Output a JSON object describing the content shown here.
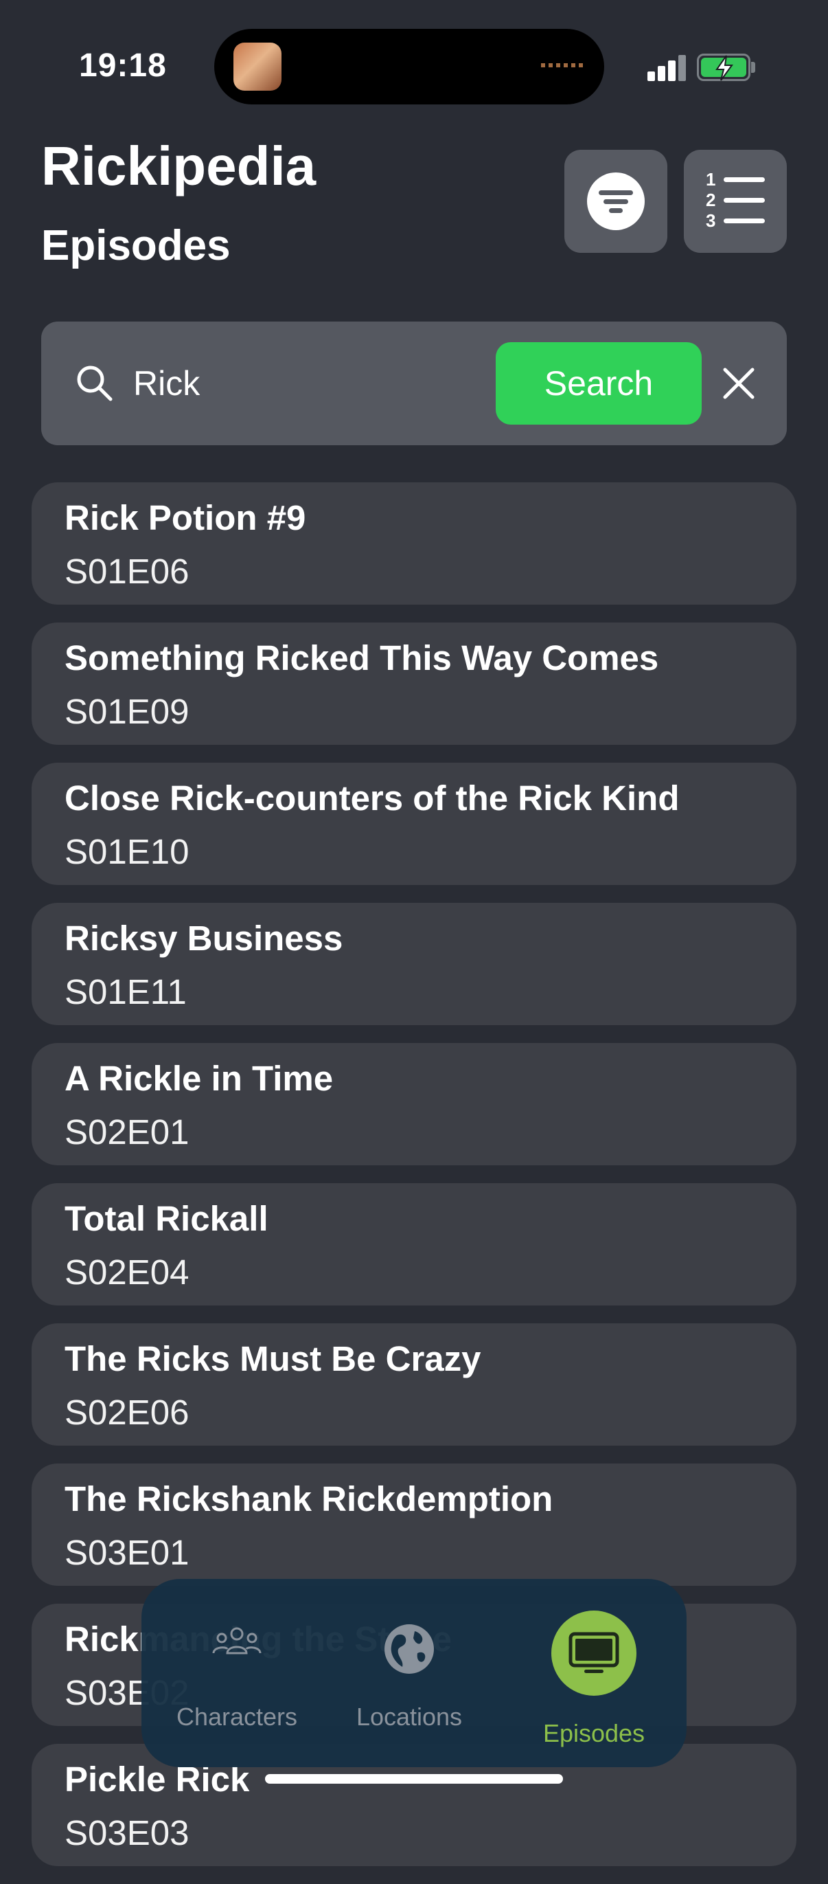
{
  "status_bar": {
    "time": "19:18"
  },
  "header": {
    "title": "Rickipedia",
    "subtitle": "Episodes"
  },
  "search": {
    "value": "Rick",
    "placeholder": "Search",
    "button_label": "Search"
  },
  "episodes": [
    {
      "name": "Rick Potion #9",
      "code": "S01E06"
    },
    {
      "name": "Something Ricked This Way Comes",
      "code": "S01E09"
    },
    {
      "name": "Close Rick-counters of the Rick Kind",
      "code": "S01E10"
    },
    {
      "name": "Ricksy Business",
      "code": "S01E11"
    },
    {
      "name": "A Rickle in Time",
      "code": "S02E01"
    },
    {
      "name": "Total Rickall",
      "code": "S02E04"
    },
    {
      "name": "The Ricks Must Be Crazy",
      "code": "S02E06"
    },
    {
      "name": "The Rickshank Rickdemption",
      "code": "S03E01"
    },
    {
      "name": "Rickmancing the Stone",
      "code": "S03E02"
    },
    {
      "name": "Pickle Rick",
      "code": "S03E03"
    }
  ],
  "tabs": [
    {
      "label": "Characters",
      "icon": "people-icon",
      "active": false
    },
    {
      "label": "Locations",
      "icon": "globe-icon",
      "active": false
    },
    {
      "label": "Episodes",
      "icon": "tv-icon",
      "active": true
    }
  ],
  "colors": {
    "background": "#292c34",
    "card": "#3d3f46",
    "accent_green": "#30d158",
    "active_tab": "#8dc04a",
    "tab_bar": "#163044"
  }
}
